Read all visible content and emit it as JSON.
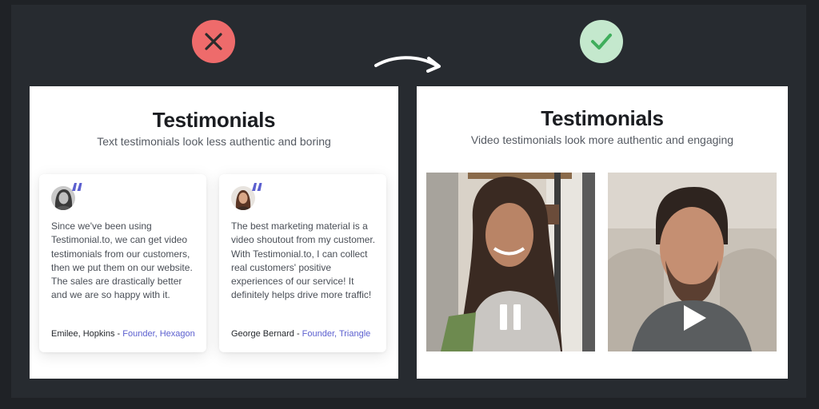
{
  "badges": {
    "bad": "close-icon",
    "good": "check-icon"
  },
  "colors": {
    "bad_badge": "#ee6b6b",
    "good_badge": "#c4e8cd",
    "good_check": "#3fae5c",
    "role_link": "#5b5fcf",
    "quote_mark": "#5b5fcf"
  },
  "left_panel": {
    "title": "Testimonials",
    "subtitle": "Text testimonials look less authentic and boring",
    "cards": [
      {
        "text": "Since we've been using Testimonial.to, we can get video testimonials from our customers, then we put them on our website. The sales are drastically better and we are so happy with it.",
        "author": "Emilee, Hopkins",
        "separator": " - ",
        "role": "Founder, Hexagon"
      },
      {
        "text": "The best marketing material is a video shoutout from my customer. With Testimonial.to, I can collect real customers' positive experiences of our service! It definitely helps drive more traffic!",
        "author": "George Bernard",
        "separator": " - ",
        "role": "Founder, Triangle"
      }
    ]
  },
  "right_panel": {
    "title": "Testimonials",
    "subtitle": "Video testimonials look more authentic and engaging",
    "videos": [
      {
        "state": "playing",
        "control": "pause-icon"
      },
      {
        "state": "paused",
        "control": "play-icon"
      }
    ]
  }
}
